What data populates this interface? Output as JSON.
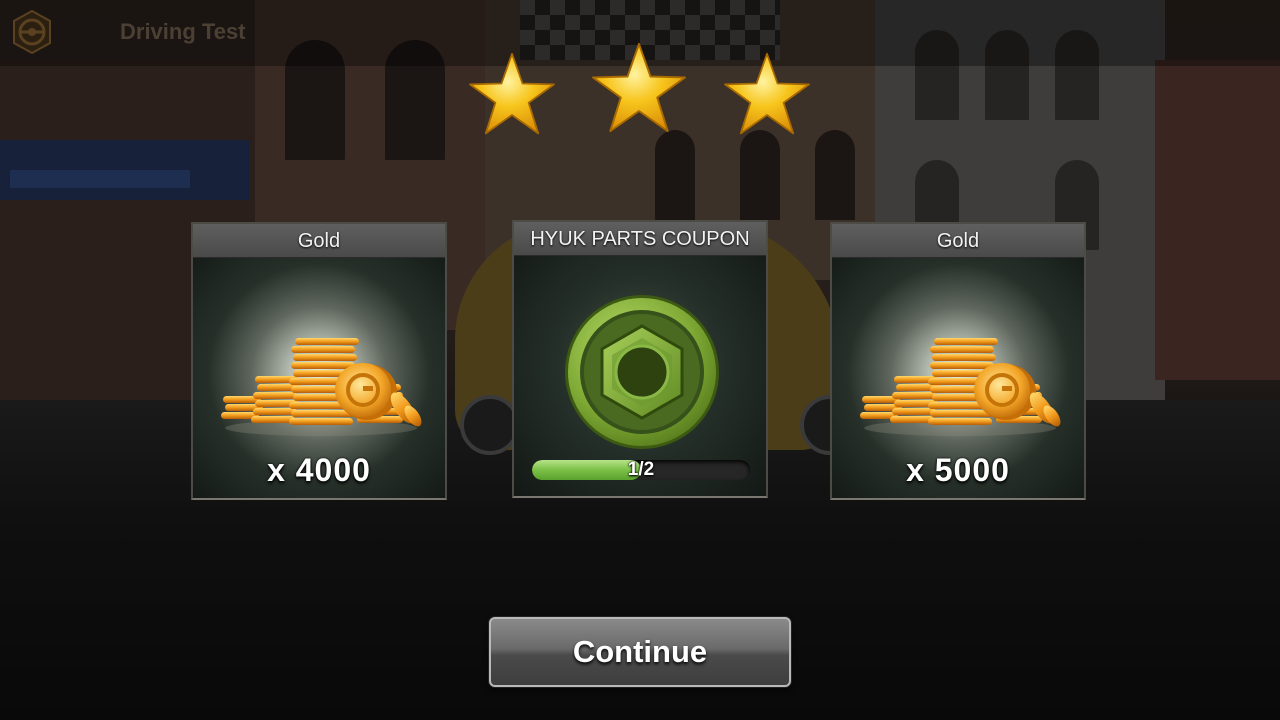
{
  "header": {
    "title": "Driving Test",
    "logo_icon": "steering-wheel-icon"
  },
  "stars": {
    "earned": 3,
    "total": 3,
    "color": "#f5c018"
  },
  "rewards": [
    {
      "title": "Gold",
      "amount_text": "x 4000",
      "icon": "gold-coins-icon"
    },
    {
      "title": "HYUK PARTS COUPON",
      "icon": "hex-nut-coupon-icon",
      "progress_text": "1/2",
      "progress": 0.5
    },
    {
      "title": "Gold",
      "amount_text": "x 5000",
      "icon": "gold-coins-icon"
    }
  ],
  "continue_button": {
    "label": "Continue"
  },
  "colors": {
    "accent_green": "#7cc046",
    "gold": "#f2a61e",
    "card_header": "#555555"
  }
}
